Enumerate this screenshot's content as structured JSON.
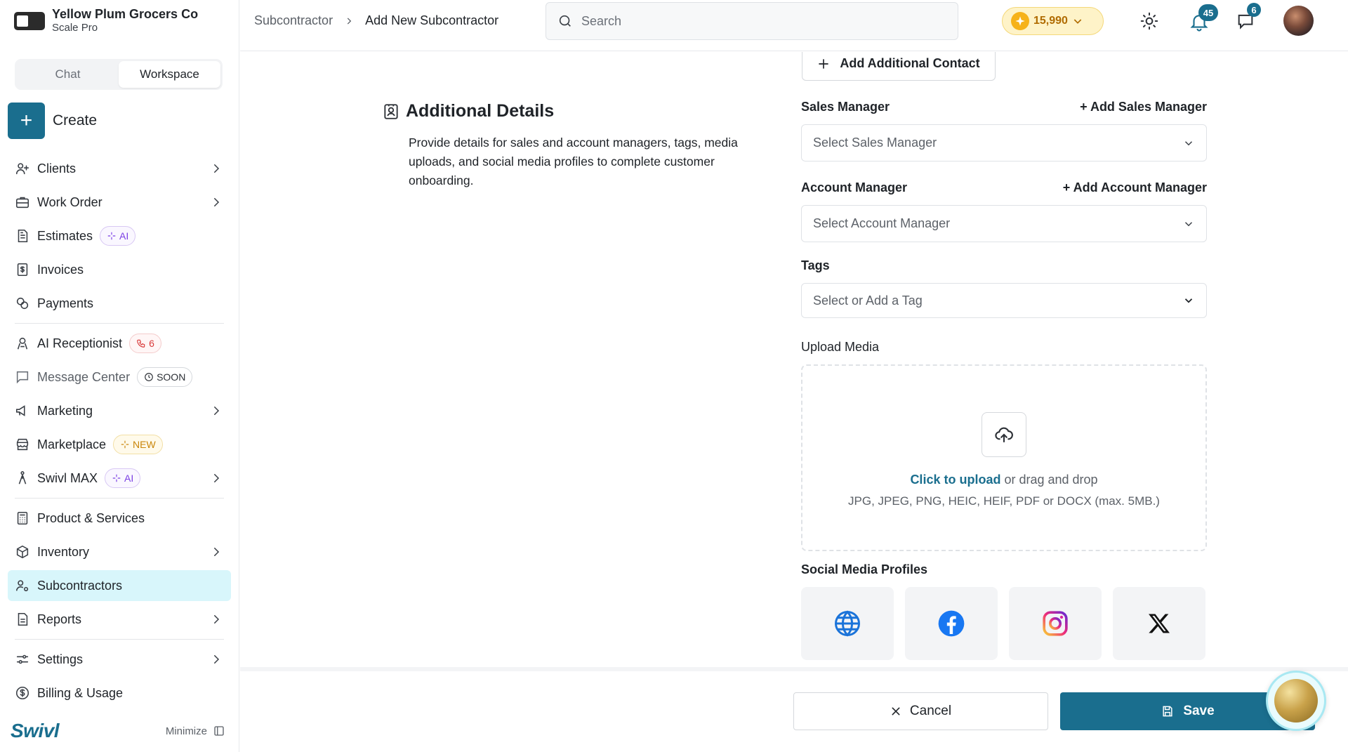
{
  "brand": {
    "name": "Yellow Plum Grocers Co",
    "plan": "Scale Pro"
  },
  "modes": {
    "chat": "Chat",
    "workspace": "Workspace"
  },
  "create_label": "Create",
  "nav": {
    "clients": "Clients",
    "work_order": "Work Order",
    "estimates": "Estimates",
    "estimates_badge": "AI",
    "invoices": "Invoices",
    "payments": "Payments",
    "ai_receptionist": "AI Receptionist",
    "ai_receptionist_badge": "6",
    "message_center": "Message Center",
    "message_center_badge": "SOON",
    "marketing": "Marketing",
    "marketplace": "Marketplace",
    "marketplace_badge": "NEW",
    "swivl_max": "Swivl MAX",
    "swivl_max_badge": "AI",
    "products": "Product & Services",
    "inventory": "Inventory",
    "subcontractors": "Subcontractors",
    "reports": "Reports",
    "settings": "Settings",
    "billing": "Billing & Usage"
  },
  "footer": {
    "logo": "Swivl",
    "minimize": "Minimize"
  },
  "breadcrumb": {
    "parent": "Subcontractor",
    "current": "Add New Subcontractor"
  },
  "search": {
    "placeholder": "Search"
  },
  "coins": {
    "value": "15,990"
  },
  "notifications": {
    "count": "45"
  },
  "messages": {
    "count": "6"
  },
  "form": {
    "add_contact": "Add Additional Contact",
    "section_title": "Additional Details",
    "section_desc": "Provide details for sales and account managers, tags, media uploads, and social media profiles to complete customer onboarding.",
    "sales_manager_label": "Sales Manager",
    "sales_manager_add": "+ Add Sales Manager",
    "sales_manager_placeholder": "Select Sales Manager",
    "account_manager_label": "Account Manager",
    "account_manager_add": "+ Add Account Manager",
    "account_manager_placeholder": "Select Account Manager",
    "tags_label": "Tags",
    "tags_placeholder": "Select or Add a Tag",
    "upload_label": "Upload Media",
    "upload_link": "Click to upload",
    "upload_rest": " or drag and drop",
    "upload_hint": "JPG, JPEG, PNG, HEIC, HEIF, PDF or DOCX (max. 5MB.)",
    "social_label": "Social Media Profiles"
  },
  "actions": {
    "cancel": "Cancel",
    "save": "Save"
  },
  "colors": {
    "accent": "#1a6e8e",
    "active_nav": "#d8f6fb",
    "coins_bg": "#fef3c8"
  }
}
